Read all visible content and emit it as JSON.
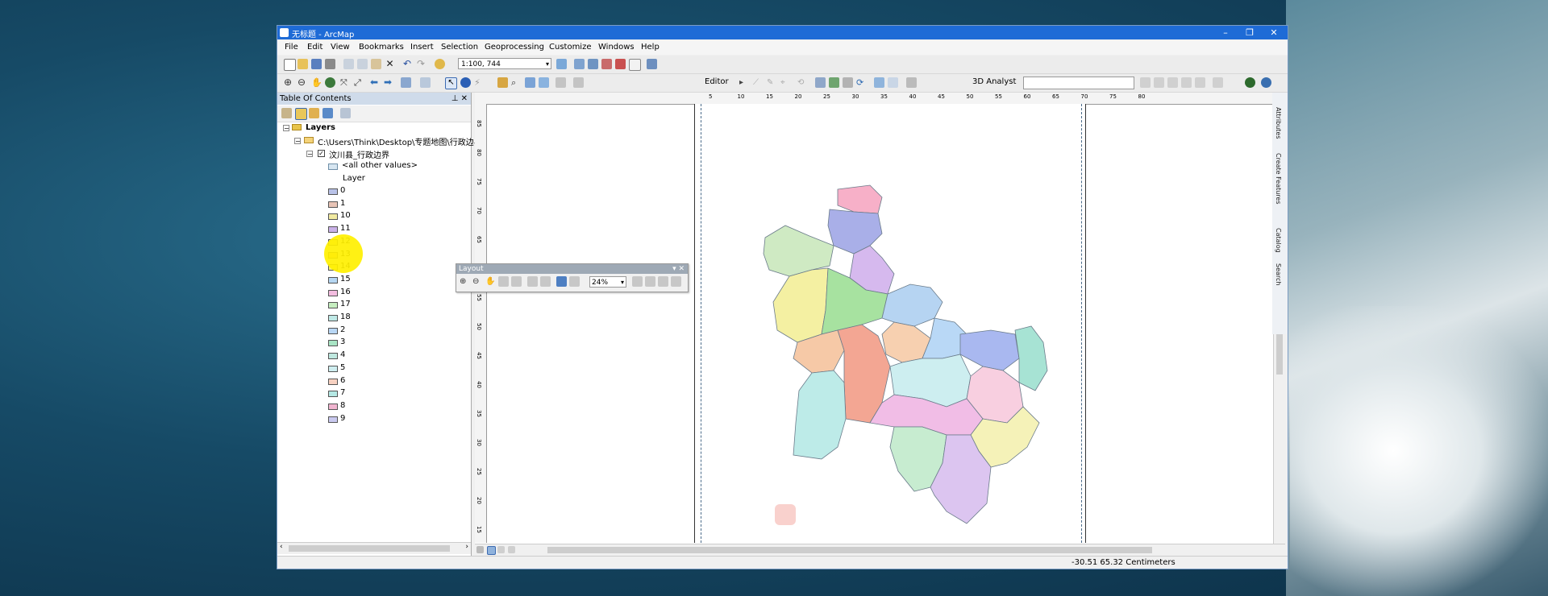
{
  "window": {
    "title": "无标题 - ArcMap"
  },
  "menu": [
    "File",
    "Edit",
    "View",
    "Bookmarks",
    "Insert",
    "Selection",
    "Geoprocessing",
    "Customize",
    "Windows",
    "Help"
  ],
  "toolbar": {
    "scale": "1:100, 744",
    "editor": "Editor",
    "analyst": "3D Analyst"
  },
  "toc": {
    "title": "Table Of Contents",
    "root": "Layers",
    "path": "C:\\Users\\Think\\Desktop\\专题地图\\行政边界",
    "layer": "汶川县_行政边界",
    "other": "<all other values>",
    "field": "Layer",
    "values": [
      "0",
      "1",
      "10",
      "11",
      "12",
      "13",
      "14",
      "15",
      "16",
      "17",
      "18",
      "2",
      "3",
      "4",
      "5",
      "6",
      "7",
      "8",
      "9"
    ]
  },
  "toc_colors": [
    "#b9c2e8",
    "#e8c4b6",
    "#f1eaa1",
    "#c9b1e8",
    "#f0e38c",
    "#f5c46e",
    "#f7f078",
    "#b6d7f2",
    "#f3bde0",
    "#c6eec0",
    "#bfe9e6",
    "#b9d7f5",
    "#a9e5c5",
    "#bfe8df",
    "#cfeef0",
    "#f7d1c1",
    "#b5e8e4",
    "#f0b4cf",
    "#c9c9ef"
  ],
  "layout_toolbar": {
    "title": "Layout",
    "zoom": "24%"
  },
  "ruler_top": [
    "5",
    "10",
    "15",
    "20",
    "25",
    "30",
    "35",
    "40",
    "45",
    "50",
    "55",
    "60",
    "65",
    "70",
    "75",
    "80"
  ],
  "ruler_left": [
    "85",
    "80",
    "75",
    "70",
    "65",
    "60",
    "55",
    "50",
    "45",
    "40",
    "35",
    "30",
    "25",
    "20",
    "15"
  ],
  "status": {
    "coords": "-30.51  65.32 Centimeters"
  },
  "sidebar_tabs": [
    "Attributes",
    "Create Features",
    "Catalog",
    "Search"
  ]
}
